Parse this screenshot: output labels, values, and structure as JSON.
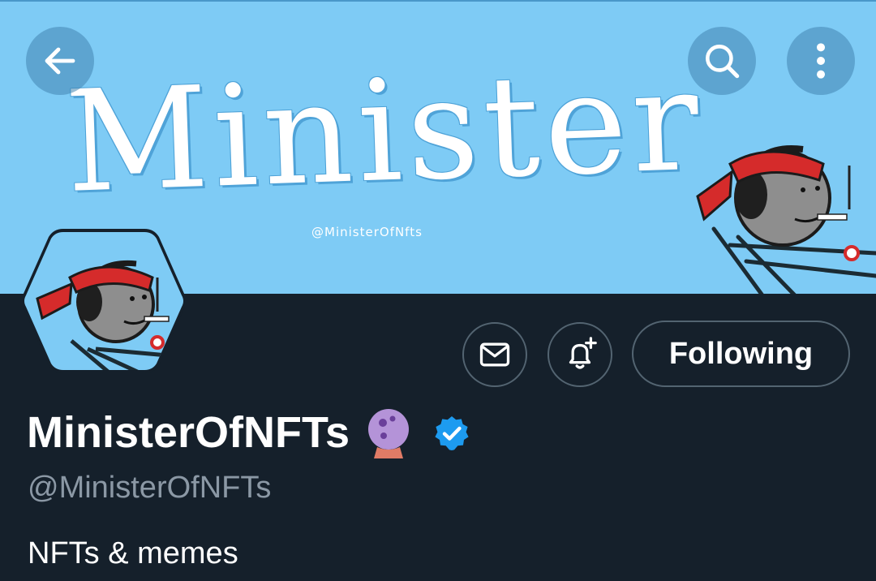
{
  "banner": {
    "title": "Minister",
    "handle": "@MinisterOfNfts",
    "background": "#7ecbf5"
  },
  "nav": {
    "back_icon": "arrow-left-icon",
    "search_icon": "search-icon",
    "more_icon": "more-vertical-icon"
  },
  "profile": {
    "display_name": "MinisterOfNFTs",
    "display_name_emoji": "crystal-ball-icon",
    "verified_badge": "verified-icon",
    "verified_color": "#1d9bf0",
    "handle": "@MinisterOfNFTs",
    "bio": "NFTs & memes"
  },
  "actions": {
    "message_icon": "envelope-icon",
    "notify_icon": "bell-plus-icon",
    "follow_label": "Following"
  },
  "colors": {
    "background": "#15202b",
    "muted_text": "#8b98a5",
    "border": "#536471"
  }
}
